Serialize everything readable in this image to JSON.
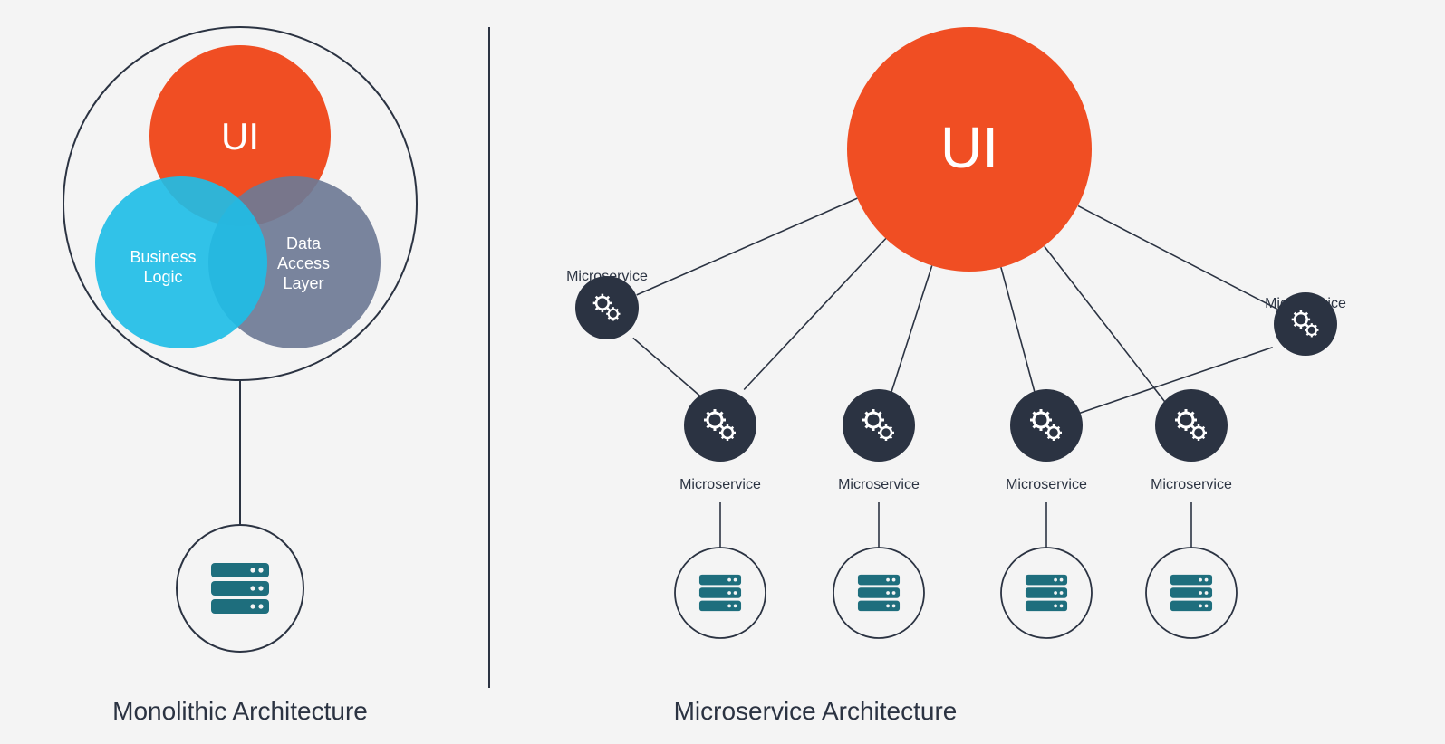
{
  "monolith": {
    "title": "Monolithic Architecture",
    "ui_label": "UI",
    "business_logic_l1": "Business",
    "business_logic_l2": "Logic",
    "data_access_l1": "Data",
    "data_access_l2": "Access",
    "data_access_l3": "Layer"
  },
  "micro": {
    "title": "Microservice Architecture",
    "ui_label": "UI",
    "ms_label": "Microservice"
  },
  "colors": {
    "orange": "#f04e23",
    "cyan": "#1fbde6",
    "slate": "#6e7a95",
    "dark": "#2b3342",
    "teal": "#1e6e7d",
    "bg": "#f4f4f4",
    "stroke": "#2b3342"
  }
}
